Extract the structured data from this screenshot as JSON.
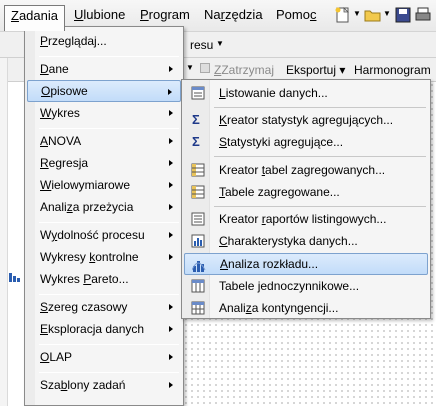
{
  "menubar": {
    "items": [
      {
        "label": "Zadania",
        "u": "Z",
        "rest": "adania"
      },
      {
        "label": "Ulubione",
        "u": "U",
        "rest": "lubione"
      },
      {
        "label": "Program",
        "u": "P",
        "rest": "rogram"
      },
      {
        "label": "Narzędzia",
        "pre": "Na",
        "u": "r",
        "rest": "zędzia"
      },
      {
        "label": "Pomoc",
        "pre": "Pomo",
        "u": "c",
        "rest": ""
      }
    ]
  },
  "background": {
    "toolbar_fragment": "resu",
    "zatrzymaj": "Zatrzymaj",
    "eksportuj": "Eksportuj",
    "harmonogram": "Harmonogram"
  },
  "menu": {
    "items": [
      {
        "label": "Przeglądaj...",
        "u": "P",
        "rest": "rzeglądaj...",
        "submenu": false
      },
      {
        "label": "Dane",
        "u": "D",
        "rest": "ane",
        "submenu": true
      },
      {
        "label": "Opisowe",
        "u": "O",
        "rest": "pisowe",
        "submenu": true
      },
      {
        "label": "Wykres",
        "u": "W",
        "rest": "ykres",
        "submenu": true
      },
      {
        "label": "ANOVA",
        "u": "A",
        "rest": "NOVA",
        "submenu": true
      },
      {
        "label": "Regresja",
        "u": "R",
        "rest": "egresja",
        "submenu": true
      },
      {
        "label": "Wielowymiarowe",
        "u": "W",
        "rest": "ielowymiarowe",
        "submenu": true
      },
      {
        "label": "Analiza przeżycia",
        "pre": "Anali",
        "u": "z",
        "rest": "a przeżycia",
        "submenu": true
      },
      {
        "label": "Wydolność procesu",
        "pre": "W",
        "u": "y",
        "rest": "dolność procesu",
        "submenu": true
      },
      {
        "label": "Wykresy kontrolne",
        "pre": "Wykresy ",
        "u": "k",
        "rest": "ontrolne",
        "submenu": true
      },
      {
        "label": "Wykres Pareto...",
        "pre": "Wykres ",
        "u": "P",
        "rest": "areto...",
        "submenu": false
      },
      {
        "label": "Szereg czasowy",
        "u": "S",
        "rest": "zereg czasowy",
        "submenu": true
      },
      {
        "label": "Eksploracja danych",
        "u": "E",
        "rest": "ksploracja danych",
        "submenu": true
      },
      {
        "label": "OLAP",
        "u": "O",
        "rest": "LAP",
        "submenu": true
      },
      {
        "label": "Szablony zadań",
        "pre": "Sza",
        "u": "b",
        "rest": "lony zadań",
        "submenu": true
      }
    ]
  },
  "submenu": {
    "items": [
      {
        "label": "Listowanie danych...",
        "u": "L",
        "rest": "istowanie danych...",
        "icon": "list-data-icon"
      },
      {
        "label": "Kreator statystyk agregujących...",
        "u": "K",
        "rest": "reator statystyk agregujących...",
        "icon": "sigma-icon"
      },
      {
        "label": "Statystyki agregujące...",
        "u": "S",
        "rest": "tatystyki agregujące...",
        "icon": "sigma-icon"
      },
      {
        "label": "Kreator tabel zagregowanych...",
        "pre": "Kreator ",
        "u": "t",
        "rest": "abel zagregowanych...",
        "icon": "table-wizard-icon"
      },
      {
        "label": "Tabele zagregowane...",
        "u": "T",
        "rest": "abele zagregowane...",
        "icon": "table-icon"
      },
      {
        "label": "Kreator raportów listingowych...",
        "pre": "Kreator ",
        "u": "r",
        "rest": "aportów listingowych...",
        "icon": "report-wizard-icon"
      },
      {
        "label": "Charakterystyka danych...",
        "u": "C",
        "rest": "harakterystyka danych...",
        "icon": "characteristics-icon"
      },
      {
        "label": "Analiza rozkładu...",
        "u": "A",
        "rest": "naliza rozkładu...",
        "icon": "histogram-icon"
      },
      {
        "label": "Tabele jednoczynnikowe...",
        "pre": "Tabele ",
        "u": "j",
        "rest": "ednoczynnikowe...",
        "icon": "one-way-table-icon"
      },
      {
        "label": "Analiza kontyngencji...",
        "pre": "Anali",
        "u": "z",
        "rest": "a kontyngencji...",
        "icon": "contingency-icon"
      }
    ]
  }
}
